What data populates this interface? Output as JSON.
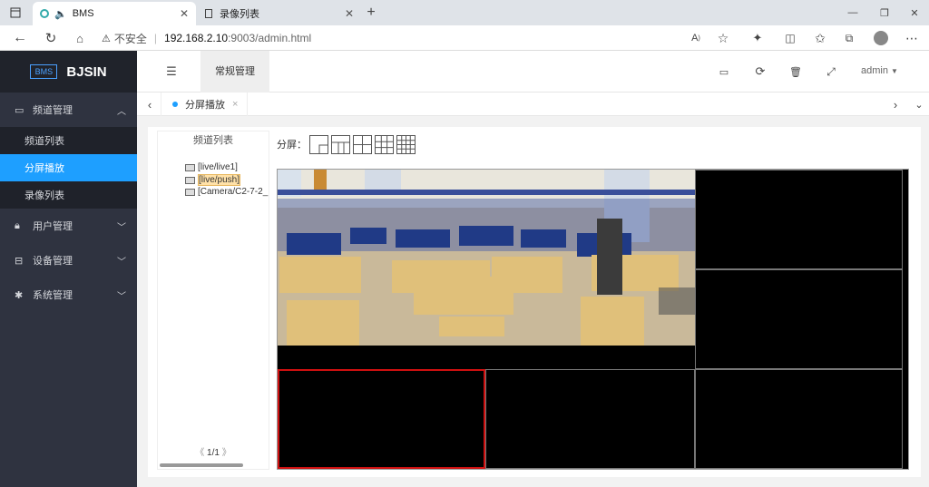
{
  "browser": {
    "tabs": [
      {
        "label": "BMS",
        "close": "✕"
      },
      {
        "label": "录像列表",
        "close": "✕"
      }
    ],
    "new_tab": "+",
    "insecure": "不安全",
    "url_host": "192.168.2.10",
    "url_rest": ":9003/admin.html",
    "window_controls": [
      "—",
      "❐",
      "✕"
    ]
  },
  "app": {
    "logo_mark": "BMS",
    "brand": "BJSIN",
    "menu": [
      {
        "label": "频道管理",
        "icon": "monitor-icon",
        "expanded": true,
        "children": [
          {
            "label": "频道列表"
          },
          {
            "label": "分屏播放",
            "active": true
          },
          {
            "label": "录像列表"
          }
        ]
      },
      {
        "label": "用户管理",
        "icon": "lock-icon"
      },
      {
        "label": "设备管理",
        "icon": "device-icon"
      },
      {
        "label": "系统管理",
        "icon": "gear-icon"
      }
    ],
    "topbar": {
      "menu_toggle": "☰",
      "nav_active": "常规管理",
      "user": "admin"
    },
    "page_tab": {
      "label": "分屏播放",
      "close": "×"
    },
    "tree": {
      "title": "频道列表",
      "nodes": [
        "[live/live1]",
        "[live/push]",
        "[Camera/C2-7-2_"
      ],
      "selected_index": 1,
      "pager": "1/1"
    },
    "split": {
      "label": "分屏：",
      "layouts": [
        "1",
        "4",
        "4-cross",
        "9",
        "16"
      ]
    },
    "accent": "#1e9fff",
    "active_cell_border": "#d01010"
  }
}
